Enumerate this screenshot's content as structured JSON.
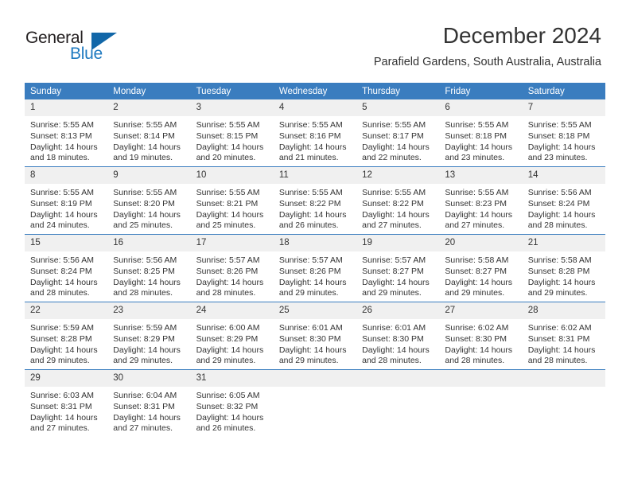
{
  "brand": {
    "name_part1": "General",
    "name_part2": "Blue",
    "logo_icon": "triangle-icon",
    "colors": {
      "dark": "#231f20",
      "blue": "#1f7ac0",
      "header_blue": "#3a7dbf",
      "daynum_bg": "#f0f0f0"
    }
  },
  "header": {
    "title": "December 2024",
    "subtitle": "Parafield Gardens, South Australia, Australia"
  },
  "calendar": {
    "weekday_headers": [
      "Sunday",
      "Monday",
      "Tuesday",
      "Wednesday",
      "Thursday",
      "Friday",
      "Saturday"
    ],
    "weeks": [
      [
        {
          "day": "1",
          "sunrise": "Sunrise: 5:55 AM",
          "sunset": "Sunset: 8:13 PM",
          "daylight": "Daylight: 14 hours and 18 minutes."
        },
        {
          "day": "2",
          "sunrise": "Sunrise: 5:55 AM",
          "sunset": "Sunset: 8:14 PM",
          "daylight": "Daylight: 14 hours and 19 minutes."
        },
        {
          "day": "3",
          "sunrise": "Sunrise: 5:55 AM",
          "sunset": "Sunset: 8:15 PM",
          "daylight": "Daylight: 14 hours and 20 minutes."
        },
        {
          "day": "4",
          "sunrise": "Sunrise: 5:55 AM",
          "sunset": "Sunset: 8:16 PM",
          "daylight": "Daylight: 14 hours and 21 minutes."
        },
        {
          "day": "5",
          "sunrise": "Sunrise: 5:55 AM",
          "sunset": "Sunset: 8:17 PM",
          "daylight": "Daylight: 14 hours and 22 minutes."
        },
        {
          "day": "6",
          "sunrise": "Sunrise: 5:55 AM",
          "sunset": "Sunset: 8:18 PM",
          "daylight": "Daylight: 14 hours and 23 minutes."
        },
        {
          "day": "7",
          "sunrise": "Sunrise: 5:55 AM",
          "sunset": "Sunset: 8:18 PM",
          "daylight": "Daylight: 14 hours and 23 minutes."
        }
      ],
      [
        {
          "day": "8",
          "sunrise": "Sunrise: 5:55 AM",
          "sunset": "Sunset: 8:19 PM",
          "daylight": "Daylight: 14 hours and 24 minutes."
        },
        {
          "day": "9",
          "sunrise": "Sunrise: 5:55 AM",
          "sunset": "Sunset: 8:20 PM",
          "daylight": "Daylight: 14 hours and 25 minutes."
        },
        {
          "day": "10",
          "sunrise": "Sunrise: 5:55 AM",
          "sunset": "Sunset: 8:21 PM",
          "daylight": "Daylight: 14 hours and 25 minutes."
        },
        {
          "day": "11",
          "sunrise": "Sunrise: 5:55 AM",
          "sunset": "Sunset: 8:22 PM",
          "daylight": "Daylight: 14 hours and 26 minutes."
        },
        {
          "day": "12",
          "sunrise": "Sunrise: 5:55 AM",
          "sunset": "Sunset: 8:22 PM",
          "daylight": "Daylight: 14 hours and 27 minutes."
        },
        {
          "day": "13",
          "sunrise": "Sunrise: 5:55 AM",
          "sunset": "Sunset: 8:23 PM",
          "daylight": "Daylight: 14 hours and 27 minutes."
        },
        {
          "day": "14",
          "sunrise": "Sunrise: 5:56 AM",
          "sunset": "Sunset: 8:24 PM",
          "daylight": "Daylight: 14 hours and 28 minutes."
        }
      ],
      [
        {
          "day": "15",
          "sunrise": "Sunrise: 5:56 AM",
          "sunset": "Sunset: 8:24 PM",
          "daylight": "Daylight: 14 hours and 28 minutes."
        },
        {
          "day": "16",
          "sunrise": "Sunrise: 5:56 AM",
          "sunset": "Sunset: 8:25 PM",
          "daylight": "Daylight: 14 hours and 28 minutes."
        },
        {
          "day": "17",
          "sunrise": "Sunrise: 5:57 AM",
          "sunset": "Sunset: 8:26 PM",
          "daylight": "Daylight: 14 hours and 28 minutes."
        },
        {
          "day": "18",
          "sunrise": "Sunrise: 5:57 AM",
          "sunset": "Sunset: 8:26 PM",
          "daylight": "Daylight: 14 hours and 29 minutes."
        },
        {
          "day": "19",
          "sunrise": "Sunrise: 5:57 AM",
          "sunset": "Sunset: 8:27 PM",
          "daylight": "Daylight: 14 hours and 29 minutes."
        },
        {
          "day": "20",
          "sunrise": "Sunrise: 5:58 AM",
          "sunset": "Sunset: 8:27 PM",
          "daylight": "Daylight: 14 hours and 29 minutes."
        },
        {
          "day": "21",
          "sunrise": "Sunrise: 5:58 AM",
          "sunset": "Sunset: 8:28 PM",
          "daylight": "Daylight: 14 hours and 29 minutes."
        }
      ],
      [
        {
          "day": "22",
          "sunrise": "Sunrise: 5:59 AM",
          "sunset": "Sunset: 8:28 PM",
          "daylight": "Daylight: 14 hours and 29 minutes."
        },
        {
          "day": "23",
          "sunrise": "Sunrise: 5:59 AM",
          "sunset": "Sunset: 8:29 PM",
          "daylight": "Daylight: 14 hours and 29 minutes."
        },
        {
          "day": "24",
          "sunrise": "Sunrise: 6:00 AM",
          "sunset": "Sunset: 8:29 PM",
          "daylight": "Daylight: 14 hours and 29 minutes."
        },
        {
          "day": "25",
          "sunrise": "Sunrise: 6:01 AM",
          "sunset": "Sunset: 8:30 PM",
          "daylight": "Daylight: 14 hours and 29 minutes."
        },
        {
          "day": "26",
          "sunrise": "Sunrise: 6:01 AM",
          "sunset": "Sunset: 8:30 PM",
          "daylight": "Daylight: 14 hours and 28 minutes."
        },
        {
          "day": "27",
          "sunrise": "Sunrise: 6:02 AM",
          "sunset": "Sunset: 8:30 PM",
          "daylight": "Daylight: 14 hours and 28 minutes."
        },
        {
          "day": "28",
          "sunrise": "Sunrise: 6:02 AM",
          "sunset": "Sunset: 8:31 PM",
          "daylight": "Daylight: 14 hours and 28 minutes."
        }
      ],
      [
        {
          "day": "29",
          "sunrise": "Sunrise: 6:03 AM",
          "sunset": "Sunset: 8:31 PM",
          "daylight": "Daylight: 14 hours and 27 minutes."
        },
        {
          "day": "30",
          "sunrise": "Sunrise: 6:04 AM",
          "sunset": "Sunset: 8:31 PM",
          "daylight": "Daylight: 14 hours and 27 minutes."
        },
        {
          "day": "31",
          "sunrise": "Sunrise: 6:05 AM",
          "sunset": "Sunset: 8:32 PM",
          "daylight": "Daylight: 14 hours and 26 minutes."
        },
        {
          "day": "",
          "sunrise": "",
          "sunset": "",
          "daylight": ""
        },
        {
          "day": "",
          "sunrise": "",
          "sunset": "",
          "daylight": ""
        },
        {
          "day": "",
          "sunrise": "",
          "sunset": "",
          "daylight": ""
        },
        {
          "day": "",
          "sunrise": "",
          "sunset": "",
          "daylight": ""
        }
      ]
    ]
  }
}
